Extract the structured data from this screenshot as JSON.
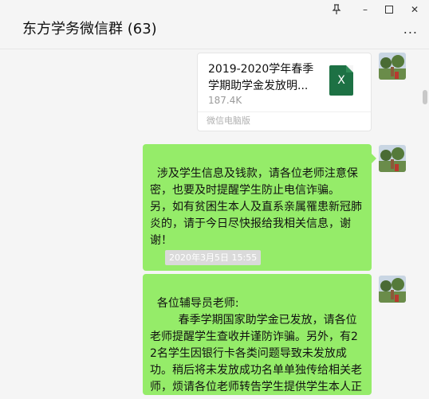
{
  "window": {
    "title": "东方学务微信群 (63)",
    "pin_icon": "pin-icon",
    "minimize_glyph": "–",
    "maximize_glyph": "☐",
    "close_glyph": "✕",
    "more_glyph": "..."
  },
  "messages": [
    {
      "type": "file",
      "file_name": "2019-2020学年春季学期助学金发放明...",
      "file_size": "187.4K",
      "file_type": "excel-icon",
      "file_type_label": "X",
      "source": "微信电脑版"
    },
    {
      "type": "text",
      "text": "涉及学生信息及钱款，请各位老师注意保密，也要及时提醒学生防止电信诈骗。\n另，如有贫困生本人及直系亲属罹患新冠肺炎的，请于今日尽快报给我相关信息，谢谢！"
    },
    {
      "type": "timestamp",
      "text": "2020年3月5日 15:55"
    },
    {
      "type": "text",
      "text": "各位辅导员老师:\n        春季学期国家助学金已发放，请各位老师提醒学生查收并谨防诈骗。另外，有22名学生因银行卡各类问题导致未发放成功。稍后将未发放成功名单单独传给相关老师，烦请各位老师转告学生提供学生本人正确的工商银行卡号。"
    }
  ],
  "colors": {
    "bubble_green": "#95ec69",
    "background": "#f5f5f5",
    "excel_green": "#1d7144"
  }
}
